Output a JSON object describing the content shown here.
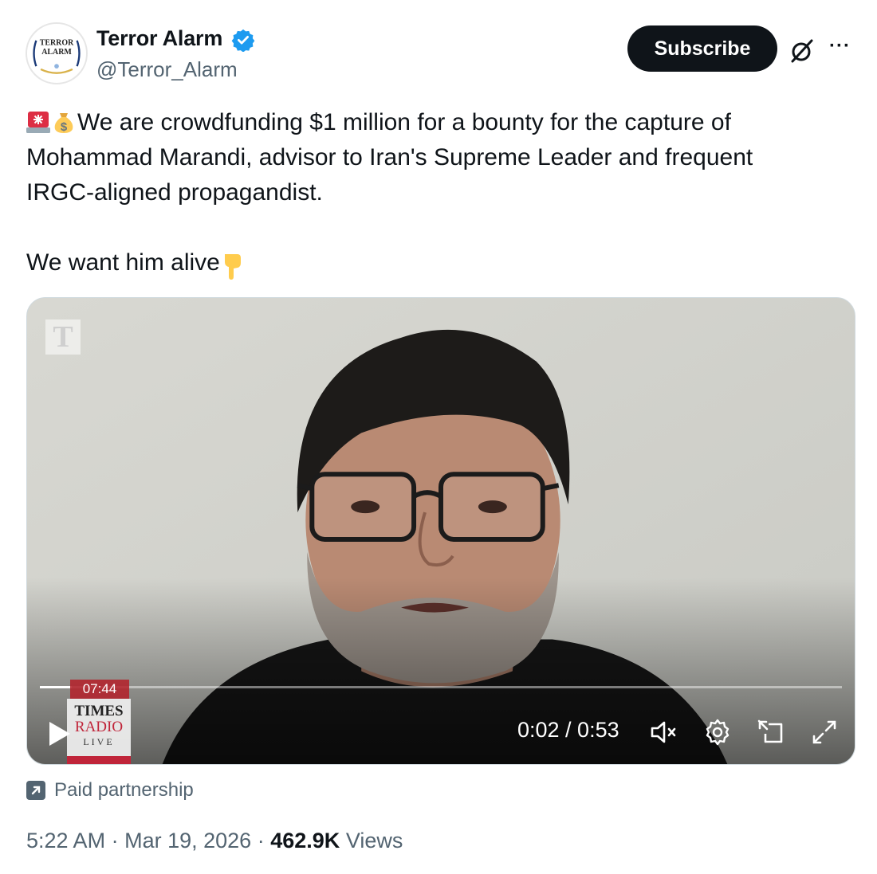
{
  "author": {
    "name": "Terror Alarm",
    "handle": "@Terror_Alarm",
    "avatar_text_line1": "TERROR",
    "avatar_text_line2": "ALARM",
    "verified_color": "#1d9bf0"
  },
  "actions": {
    "subscribe_label": "Subscribe",
    "grok_icon": "grok-icon",
    "more_icon": "more-options-icon",
    "more_label": "···"
  },
  "tweet": {
    "line1": "We are crowdfunding $1 million for a bounty for the capture of",
    "line2": "Mohammad Marandi, advisor to Iran's Supreme Leader and frequent",
    "line3": "IRGC-aligned propagandist.",
    "line4": "We want him alive",
    "emoji_1": "rotating-light",
    "emoji_2": "money-bag",
    "emoji_3": "backhand-index-pointing-down"
  },
  "video": {
    "watermark": "T",
    "chapter_time": "07:44",
    "channel_line1": "TIMES",
    "channel_line2": "RADIO",
    "channel_line3": "LIVE",
    "current_time": "0:02",
    "duration": "0:53",
    "time_display": "0:02 / 0:53",
    "progress_fraction": 0.04,
    "controls": [
      "play-icon",
      "mute-icon",
      "settings-icon",
      "pip-icon",
      "fullscreen-icon"
    ]
  },
  "footer": {
    "paid_label": "Paid partnership",
    "time": "5:22 AM",
    "date": "Mar 19, 2026",
    "separator": "·",
    "views_count": "462.9K",
    "views_label": "Views"
  },
  "colors": {
    "text_primary": "#0f1419",
    "text_secondary": "#536471",
    "button_bg": "#0f1419",
    "accent_red": "#c0253a"
  }
}
